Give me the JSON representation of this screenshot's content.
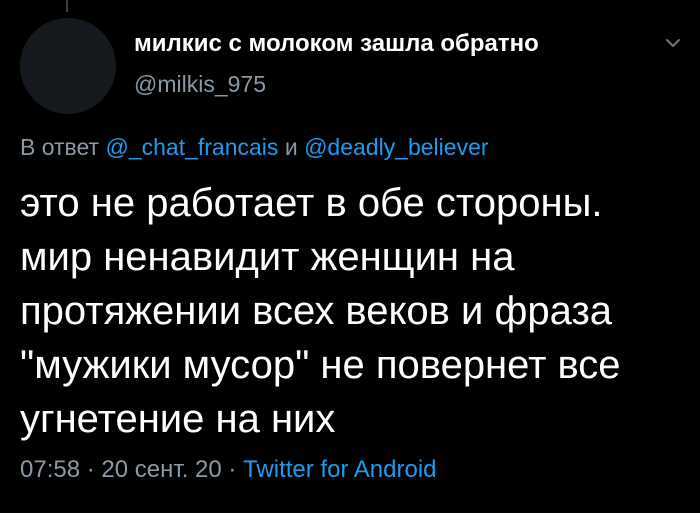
{
  "tweet": {
    "display_name": "милкис с молоком зашла обратно",
    "handle": "@milkis_975",
    "reply_prefix": "В ответ",
    "reply_mention_1": "@_chat_francais",
    "reply_joiner": "и",
    "reply_mention_2": "@deadly_believer",
    "text_lines": [
      "это не работает в обе стороны.",
      "мир ненавидит женщин на",
      "протяжении всех веков и фраза",
      "\"мужики мусор\" не повернет все",
      "угнетение на них"
    ],
    "time": "07:58",
    "date": "20 сент. 20",
    "separator": "·",
    "source": "Twitter for Android"
  },
  "icons": {
    "menu": "chevron-down-icon"
  },
  "colors": {
    "background": "#000000",
    "text": "#ffffff",
    "secondary": "#8b98a5",
    "link": "#1d9bf0"
  }
}
